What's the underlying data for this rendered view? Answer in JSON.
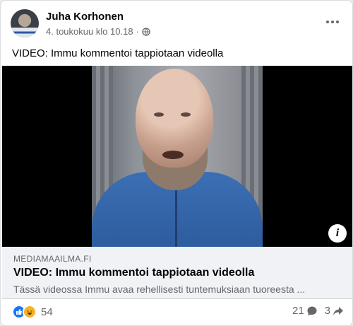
{
  "post": {
    "author": "Juha Korhonen",
    "timestamp": "4. toukokuu klo 10.18",
    "separator": "·",
    "privacy_icon": "globe-icon",
    "text": "VIDEO: Immu kommentoi tappiotaan videolla"
  },
  "link": {
    "domain": "MEDIAMAAILMA.FI",
    "title": "VIDEO: Immu kommentoi tappiotaan videolla",
    "description": "Tässä videossa Immu avaa rehellisesti tuntemuksiaan tuoreesta ...",
    "info_label": "i"
  },
  "stats": {
    "reaction_icons": [
      "like-icon",
      "haha-icon"
    ],
    "reaction_count": "54",
    "comment_count": "21",
    "share_count": "3"
  },
  "colors": {
    "like": "#1877f2",
    "haha": "#f7b125",
    "secondary_text": "#65676b"
  }
}
